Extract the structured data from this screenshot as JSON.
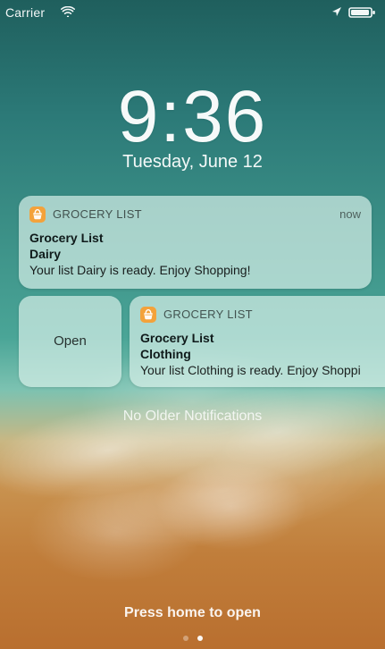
{
  "status_bar": {
    "carrier": "Carrier",
    "icons": [
      "wifi-icon",
      "location-icon",
      "battery-icon"
    ]
  },
  "lock_screen": {
    "time": "9:36",
    "date": "Tuesday, June 12"
  },
  "notifications": [
    {
      "app_name": "GROCERY LIST",
      "timestamp": "now",
      "title": "Grocery List",
      "subtitle": "Dairy",
      "body": "Your list Dairy is ready. Enjoy Shopping!"
    },
    {
      "app_name": "GROCERY LIST",
      "title": "Grocery List",
      "subtitle": "Clothing",
      "body": "Your list Clothing is ready. Enjoy Shoppi"
    }
  ],
  "actions": {
    "open_label": "Open"
  },
  "footer": {
    "no_older": "No Older Notifications",
    "press_home": "Press home to open"
  },
  "colors": {
    "notification_bg": "#D7F0E8",
    "app_icon": "#F3A23B"
  }
}
